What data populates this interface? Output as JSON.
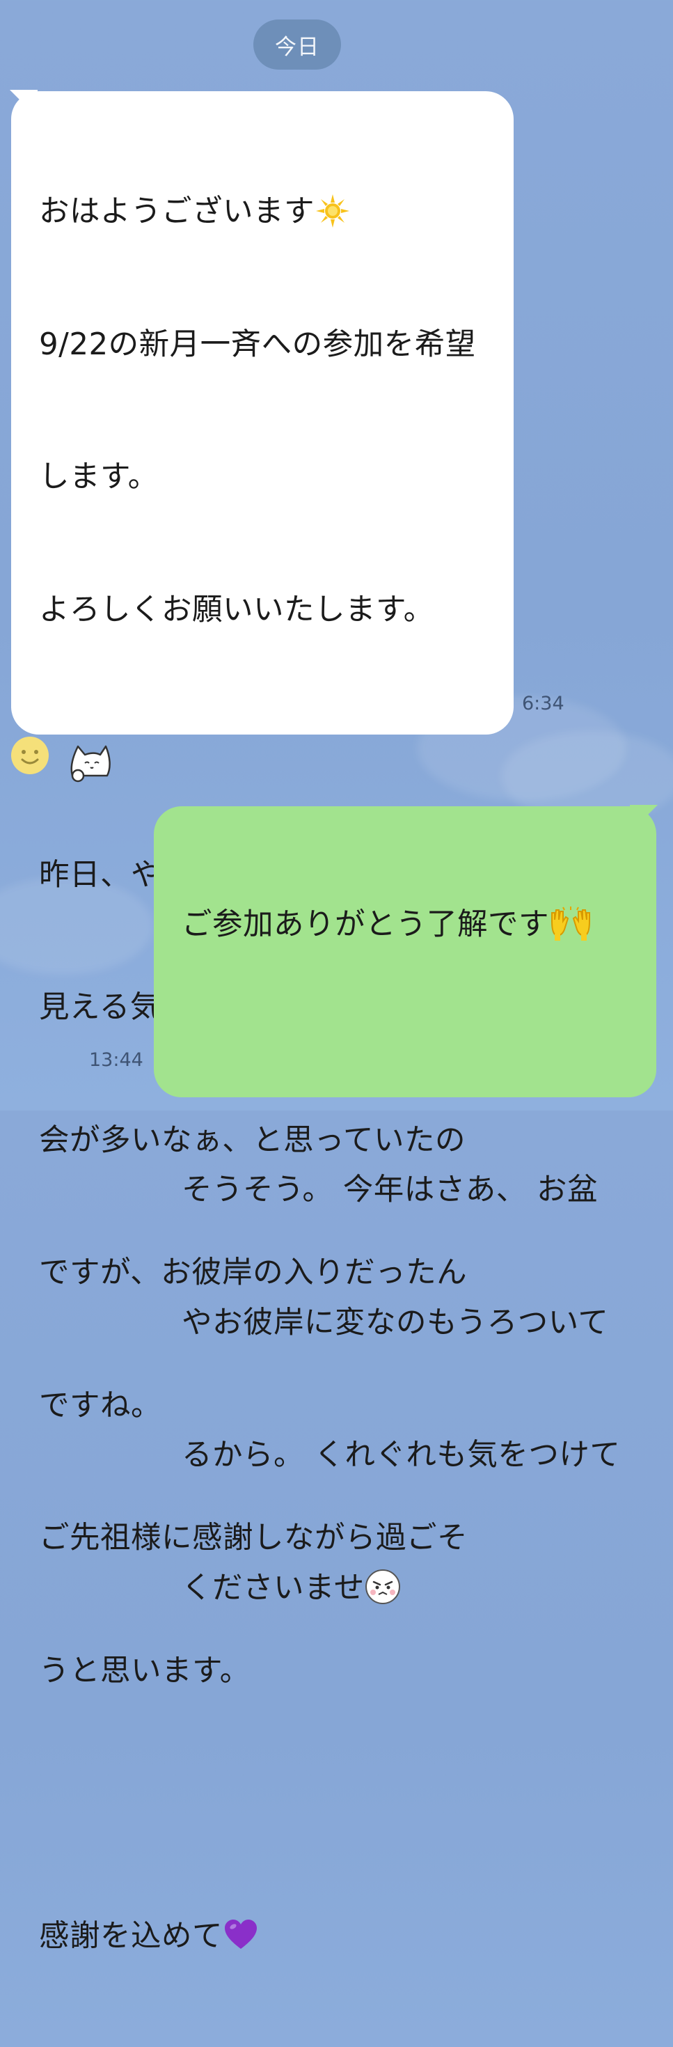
{
  "date_separator": "今日",
  "incoming_message": {
    "lines": [
      "おはようございます",
      "9/22の新月一斉への参加を希望",
      "します。",
      "よろしくお願いいたします。",
      "",
      "昨日、やたらと視界の端に何か",
      "見える気がして、二度見する機",
      "会が多いなぁ、と思っていたの",
      "ですが、お彼岸の入りだったん",
      "ですね。",
      "ご先祖様に感謝しながら過ごそ",
      "うと思います。",
      "",
      "感謝を込めて"
    ],
    "emoji_line1": "sun-emoji",
    "emoji_last": "purple-heart-emoji",
    "time": "6:34"
  },
  "reactions": [
    "smile-emoji",
    "cat-sticker-icon"
  ],
  "outgoing_message": {
    "lines": [
      "ご参加ありがとう了解です",
      "",
      "そうそう。 今年はさあ、 お盆",
      "やお彼岸に変なのもうろついて",
      "るから。 くれぐれも気をつけて",
      "くださいませ"
    ],
    "emoji_line1": "cheering-hands-emoji",
    "emoji_last": "grumpy-face-emoji",
    "time": "13:44"
  },
  "colors": {
    "background": "#8aa9d8",
    "incoming_bubble": "#ffffff",
    "outgoing_bubble": "#a2e38e",
    "date_pill": "#6e8fb9"
  }
}
